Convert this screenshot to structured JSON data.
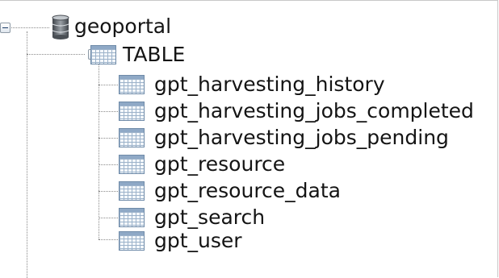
{
  "tree": {
    "root": {
      "label": "geoportal",
      "icon": "database-icon",
      "expanded": true,
      "children": [
        {
          "label": "TABLE",
          "icon": "table-folder-icon",
          "expanded": true,
          "children": [
            {
              "label": "gpt_harvesting_history",
              "icon": "table-icon"
            },
            {
              "label": "gpt_harvesting_jobs_completed",
              "icon": "table-icon"
            },
            {
              "label": "gpt_harvesting_jobs_pending",
              "icon": "table-icon"
            },
            {
              "label": "gpt_resource",
              "icon": "table-icon"
            },
            {
              "label": "gpt_resource_data",
              "icon": "table-icon"
            },
            {
              "label": "gpt_search",
              "icon": "table-icon"
            },
            {
              "label": "gpt_user",
              "icon": "table-icon"
            }
          ]
        }
      ]
    }
  },
  "colors": {
    "connector": "#8a8a8a",
    "toggle_border": "#8e9aa6",
    "table_icon_border": "#6e8aa8",
    "database_icon": "#5a5f66"
  }
}
